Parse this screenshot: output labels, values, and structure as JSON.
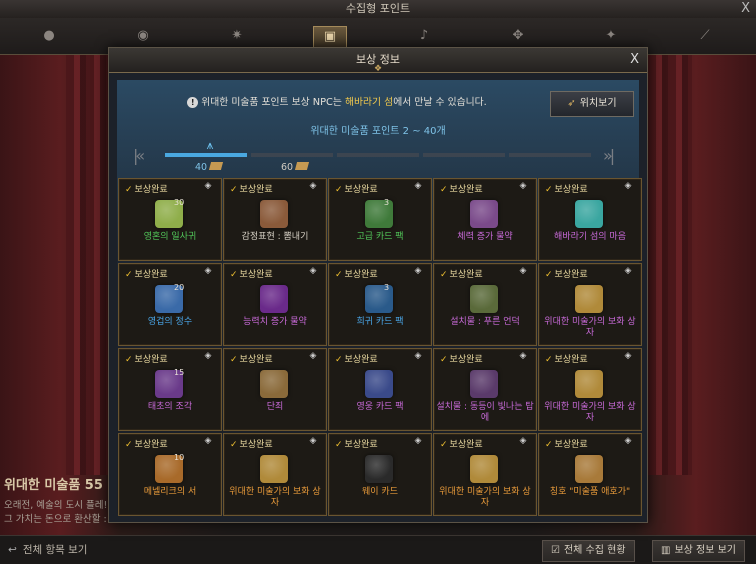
{
  "window": {
    "title": "수집형 포인트",
    "close_label": "X"
  },
  "tabs": [
    {
      "icon": "sphere-icon"
    },
    {
      "icon": "orb-icon"
    },
    {
      "icon": "sun-icon"
    },
    {
      "icon": "painting-icon",
      "active": true
    },
    {
      "icon": "music-note-icon"
    },
    {
      "icon": "crest-icon"
    },
    {
      "icon": "leaf-icon"
    },
    {
      "icon": "sword-icon"
    }
  ],
  "background": {
    "story_title": "위대한 미술품 55",
    "story_lines": [
      "오래전, 예술의 도시 플레!",
      "그 가치는 돈으로 환산할 :"
    ]
  },
  "bottom_bar": {
    "view_all": "전체 항목 보기",
    "collect_status": "전체 수집 현황",
    "reward_info": "보상 정보 보기"
  },
  "modal": {
    "title": "보상 정보",
    "close_label": "X",
    "info_prefix": "위대한 미술품 포인트 보상 NPC는 ",
    "info_highlight": "해바라기 섬",
    "info_suffix": "에서 만날 수 있습니다.",
    "location_button": "위치보기",
    "range_text": "위대한 미술품 포인트 2 ~ 40개",
    "progress_labels": [
      "40",
      "60"
    ]
  },
  "rewards": [
    {
      "status": "보상완료",
      "name": "영혼의 일사귀",
      "qty": "30",
      "name_color": "#52c85a",
      "icon_color": "#8fae4a"
    },
    {
      "status": "보상완료",
      "name": "감정표현 : 뽐내기",
      "qty": "",
      "name_color": "#d8d2c6",
      "icon_color": "#8a5a3a"
    },
    {
      "status": "보상완료",
      "name": "고급 카드 팩",
      "qty": "3",
      "name_color": "#52c85a",
      "icon_color": "#3f7a3a"
    },
    {
      "status": "보상완료",
      "name": "체력 증가 물약",
      "qty": "",
      "name_color": "#c86ad8",
      "icon_color": "#7a4a8a"
    },
    {
      "status": "보상완료",
      "name": "해바라기 섬의 마음",
      "qty": "",
      "name_color": "#c86ad8",
      "icon_color": "#3aa6a0"
    },
    {
      "status": "보상완료",
      "name": "영겁의 정수",
      "qty": "20",
      "name_color": "#4aa6e8",
      "icon_color": "#3a6aa8"
    },
    {
      "status": "보상완료",
      "name": "능력치 증가 물약",
      "qty": "",
      "name_color": "#c86ad8",
      "icon_color": "#6a2a8a"
    },
    {
      "status": "보상완료",
      "name": "희귀 카드 팩",
      "qty": "3",
      "name_color": "#4aa6e8",
      "icon_color": "#2a5a8a"
    },
    {
      "status": "보상완료",
      "name": "설치물 : 푸른 언덕",
      "qty": "",
      "name_color": "#c86ad8",
      "icon_color": "#5a6a3a"
    },
    {
      "status": "보상완료",
      "name": "위대한 미술가의 보화 상자",
      "qty": "",
      "name_color": "#c86ad8",
      "icon_color": "#b08a3a"
    },
    {
      "status": "보상완료",
      "name": "태초의 조각",
      "qty": "15",
      "name_color": "#c86ad8",
      "icon_color": "#6a3a8a"
    },
    {
      "status": "보상완료",
      "name": "단죄",
      "qty": "",
      "name_color": "#c86ad8",
      "icon_color": "#8a6a3a"
    },
    {
      "status": "보상완료",
      "name": "영웅 카드 팩",
      "qty": "",
      "name_color": "#c86ad8",
      "icon_color": "#3a4a8a"
    },
    {
      "status": "보상완료",
      "name": "설치물 : 동등이 빛나는 탑에",
      "qty": "",
      "name_color": "#c86ad8",
      "icon_color": "#5a3a6a"
    },
    {
      "status": "보상완료",
      "name": "위대한 미술가의 보화 상자",
      "qty": "",
      "name_color": "#c86ad8",
      "icon_color": "#b08a3a"
    },
    {
      "status": "보상완료",
      "name": "메넬리크의 서",
      "qty": "10",
      "name_color": "#e89a3a",
      "icon_color": "#a86a2a"
    },
    {
      "status": "보상완료",
      "name": "위대한 미술가의 보화 상자",
      "qty": "",
      "name_color": "#e89a3a",
      "icon_color": "#b08a3a"
    },
    {
      "status": "보상완료",
      "name": "웨이 카드",
      "qty": "",
      "name_color": "#e89a3a",
      "icon_color": "#2a2a2a"
    },
    {
      "status": "보상완료",
      "name": "위대한 미술가의 보화 상자",
      "qty": "",
      "name_color": "#e89a3a",
      "icon_color": "#b08a3a"
    },
    {
      "status": "보상완료",
      "name": "칭호 \"미술품 애호가\"",
      "qty": "",
      "name_color": "#e89a3a",
      "icon_color": "#a87a3a"
    }
  ]
}
